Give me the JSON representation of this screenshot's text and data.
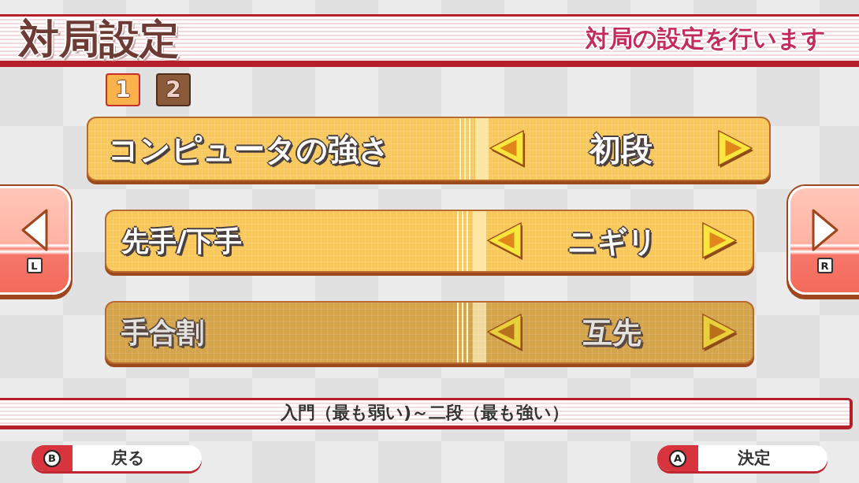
{
  "header": {
    "title": "対局設定",
    "subtitle": "対局の設定を行います"
  },
  "pages": [
    {
      "label": "1",
      "selected": true
    },
    {
      "label": "2",
      "selected": false
    }
  ],
  "page_nav": [
    {
      "kind": "previous",
      "key": "L"
    },
    {
      "kind": "next",
      "key": "R"
    }
  ],
  "settings": [
    {
      "label": "コンピュータの強さ",
      "value": "初段",
      "selected": true,
      "disabled": false
    },
    {
      "label": "先手/下手",
      "value": "ニギリ",
      "selected": false,
      "disabled": false
    },
    {
      "label": "手合割",
      "value": "互先",
      "selected": false,
      "disabled": true
    }
  ],
  "description": "入門（最も弱い)～二段（最も強い）",
  "buttons": [
    {
      "key": "B",
      "label": "戻る"
    },
    {
      "key": "A",
      "label": "決定"
    }
  ]
}
